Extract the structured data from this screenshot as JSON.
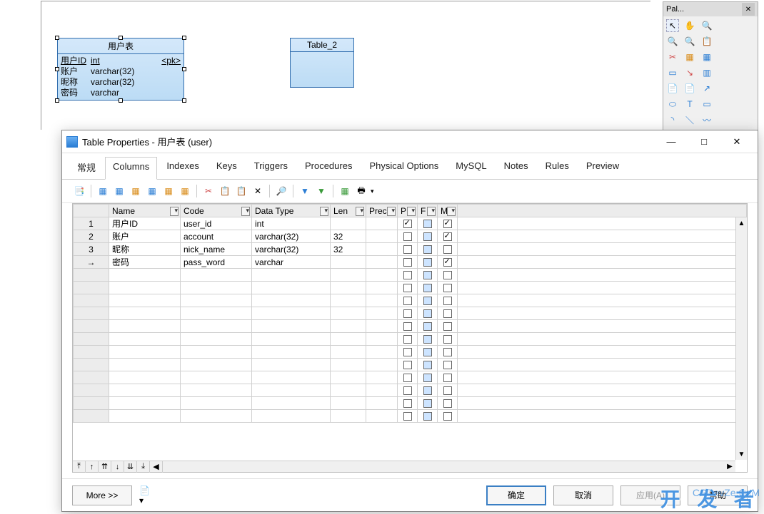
{
  "canvas": {
    "entity1": {
      "title": "用户表",
      "rows": [
        {
          "col": "用户ID",
          "type": "int",
          "key": "<pk>"
        },
        {
          "col": "账户",
          "type": "varchar(32)",
          "key": ""
        },
        {
          "col": "昵称",
          "type": "varchar(32)",
          "key": ""
        },
        {
          "col": "密码",
          "type": "varchar",
          "key": ""
        }
      ]
    },
    "entity2": {
      "title": "Table_2"
    }
  },
  "palette": {
    "title": "Pal..."
  },
  "dialog": {
    "title": "Table Properties - 用户表 (user)",
    "tabs": [
      "常规",
      "Columns",
      "Indexes",
      "Keys",
      "Triggers",
      "Procedures",
      "Physical Options",
      "MySQL",
      "Notes",
      "Rules",
      "Preview"
    ],
    "active_tab": 1,
    "grid": {
      "headers": {
        "name": "Name",
        "code": "Code",
        "type": "Data Type",
        "len": "Len",
        "prec": "Prec",
        "p": "P",
        "f": "F",
        "m": "M"
      },
      "rows": [
        {
          "n": "1",
          "name": "用户ID",
          "code": "user_id",
          "type": "int",
          "len": "",
          "prec": "",
          "p": true,
          "f": false,
          "m": true
        },
        {
          "n": "2",
          "name": "账户",
          "code": "account",
          "type": "varchar(32)",
          "len": "32",
          "prec": "",
          "p": false,
          "f": false,
          "m": true
        },
        {
          "n": "3",
          "name": "昵称",
          "code": "nick_name",
          "type": "varchar(32)",
          "len": "32",
          "prec": "",
          "p": false,
          "f": false,
          "m": false
        },
        {
          "n": "→",
          "name": "密码",
          "code": "pass_word",
          "type": "varchar",
          "len": "",
          "prec": "",
          "p": false,
          "f": false,
          "m": true
        }
      ]
    },
    "footer": {
      "more": "More >>",
      "ok": "确定",
      "cancel": "取消",
      "apply": "应用(A)",
      "help": "帮助"
    }
  },
  "watermark": {
    "cn": "开 发 者",
    "en": "CSDevZe.CoM"
  }
}
